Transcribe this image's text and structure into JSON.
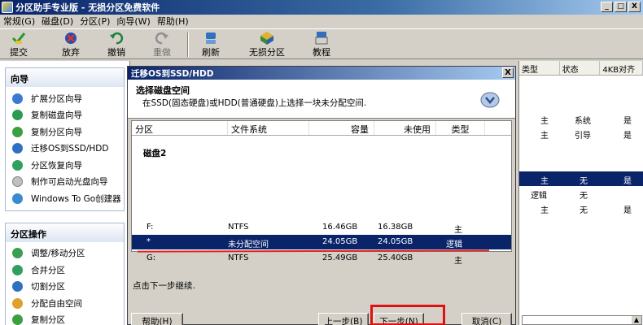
{
  "window": {
    "title": "分区助手专业版 - 无损分区免费软件",
    "controls": [
      "_",
      "□",
      "X"
    ]
  },
  "menubar": {
    "items": [
      "常规(G)",
      "磁盘(D)",
      "分区(P)",
      "向导(W)",
      "帮助(H)"
    ]
  },
  "toolbar": {
    "buttons": [
      {
        "label": "提交",
        "icon": "check-icon"
      },
      {
        "label": "放弃",
        "icon": "cancel-icon"
      },
      {
        "label": "撤销",
        "icon": "undo-icon"
      },
      {
        "label": "重做",
        "icon": "redo-icon"
      },
      {
        "label": "刷新",
        "icon": "refresh-icon"
      },
      {
        "label": "无损分区",
        "icon": "partition-icon"
      },
      {
        "label": "教程",
        "icon": "tutorial-icon"
      }
    ]
  },
  "leftpane": {
    "wizard_title": "向导",
    "wizard_items": [
      "扩展分区向导",
      "复制磁盘向导",
      "复制分区向导",
      "迁移OS到SSD/HDD",
      "分区恢复向导",
      "制作可启动光盘向导",
      "Windows To Go创建器"
    ],
    "ops_title": "分区操作",
    "ops_items": [
      "调整/移动分区",
      "合并分区",
      "切割分区",
      "分配自由空间",
      "复制分区"
    ]
  },
  "dialog": {
    "title": "迁移OS到SSD/HDD",
    "close": "X",
    "header_title": "选择磁盘空间",
    "header_sub": "在SSD(固态硬盘)或HDD(普通硬盘)上选择一块未分配空间.",
    "columns": [
      "分区",
      "文件系统",
      "容量",
      "未使用",
      "类型"
    ],
    "disk_label": "磁盘2",
    "rows": [
      {
        "part": "F:",
        "fs": "NTFS",
        "cap": "16.46GB",
        "free": "16.38GB",
        "type": "主"
      },
      {
        "part": "*",
        "fs": "未分配空间",
        "cap": "24.05GB",
        "free": "24.05GB",
        "type": "逻辑"
      },
      {
        "part": "G:",
        "fs": "NTFS",
        "cap": "25.49GB",
        "free": "25.40GB",
        "type": "主"
      }
    ],
    "hint": "点击下一步继续.",
    "help_button": "帮助(H)",
    "back_button": "上一步(B)",
    "next_button": "下一步(N)",
    "cancel_button": "取消(C)"
  },
  "rightpane": {
    "columns": [
      "类型",
      "状态",
      "4KB对齐"
    ],
    "rows": [
      {
        "type": "主",
        "status": "系统",
        "align": "是"
      },
      {
        "type": "主",
        "status": "引导",
        "align": "是"
      },
      {
        "type": "主",
        "status": "无",
        "align": "是"
      },
      {
        "type": "逻辑",
        "status": "无",
        "align": ""
      },
      {
        "type": "主",
        "status": "无",
        "align": "是"
      }
    ],
    "scroll_arrow": "▲"
  }
}
